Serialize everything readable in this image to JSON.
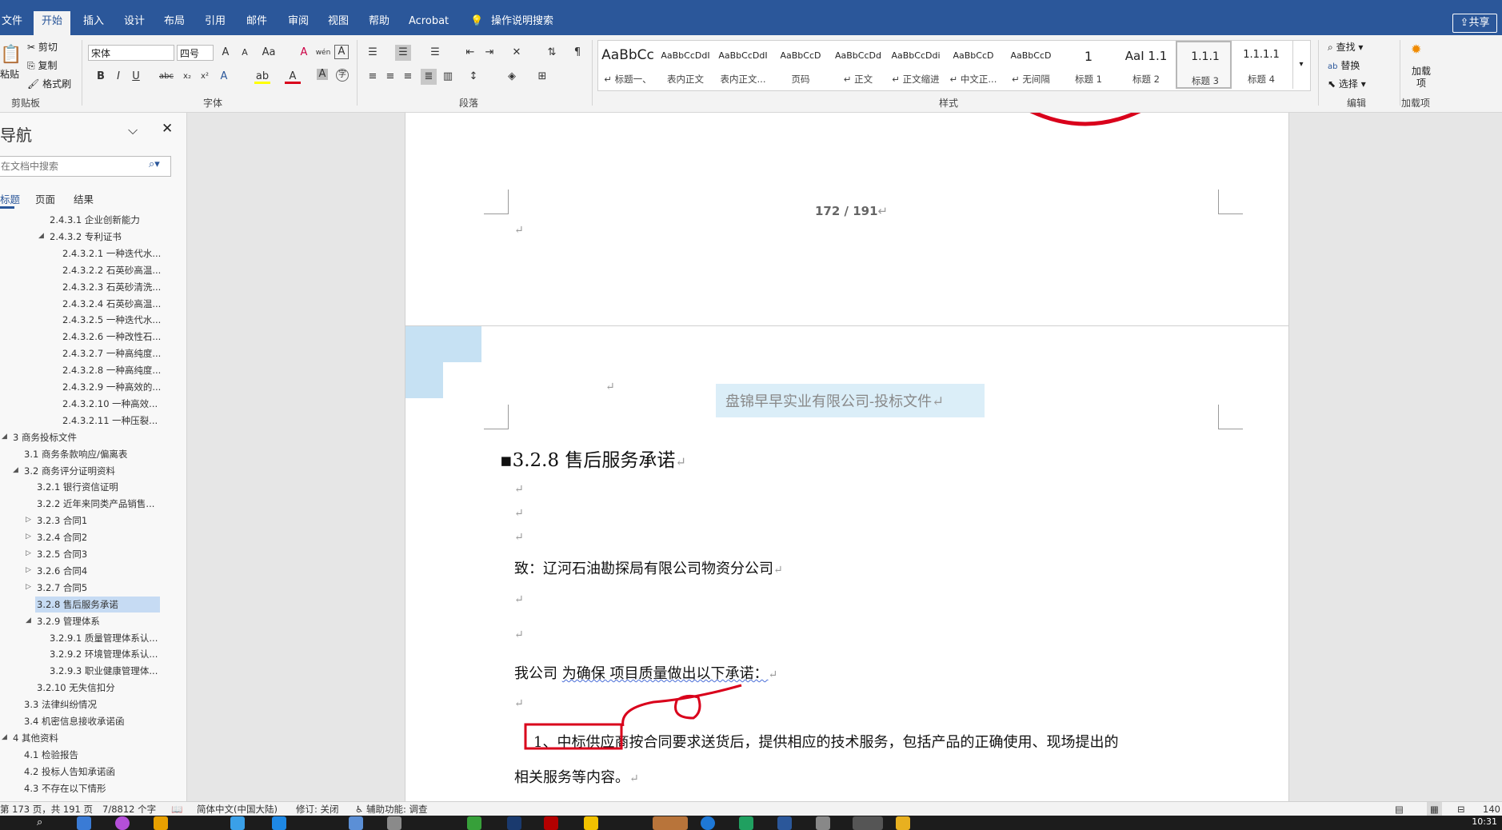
{
  "ribbon_tabs": [
    "文件",
    "开始",
    "插入",
    "设计",
    "布局",
    "引用",
    "邮件",
    "审阅",
    "视图",
    "帮助",
    "Acrobat"
  ],
  "tell_me": "操作说明搜索",
  "share": "共享",
  "clipboard": {
    "paste": "粘贴",
    "cut": "剪切",
    "copy": "复制",
    "format_painter": "格式刷",
    "label": "剪贴板"
  },
  "font": {
    "name": "宋体",
    "size": "四号",
    "label": "字体",
    "bold": "B",
    "italic": "I",
    "underline": "U",
    "strike": "abc"
  },
  "paragraph": {
    "label": "段落"
  },
  "styles": {
    "label": "样式",
    "items": [
      {
        "preview": "AaBbCc",
        "name": "↵ 标题一、"
      },
      {
        "preview": "AaBbCcDdI",
        "name": "表内正文"
      },
      {
        "preview": "AaBbCcDdI",
        "name": "表内正文..."
      },
      {
        "preview": "AaBbCcD",
        "name": "页码"
      },
      {
        "preview": "AaBbCcDd",
        "name": "↵ 正文"
      },
      {
        "preview": "AaBbCcDdi",
        "name": "↵ 正文缩进"
      },
      {
        "preview": "AaBbCcD",
        "name": "↵ 中文正..."
      },
      {
        "preview": "AaBbCcD",
        "name": "↵ 无间隔"
      },
      {
        "preview": "1",
        "name": "标题 1"
      },
      {
        "preview": "AaI 1.1",
        "name": "标题 2"
      },
      {
        "preview": "1.1.1",
        "name": "标题 3"
      },
      {
        "preview": "1.1.1.1",
        "name": "标题 4"
      }
    ]
  },
  "editing": {
    "find": "查找",
    "replace": "替换",
    "select": "选择",
    "label": "编辑"
  },
  "addins": {
    "btn": "加载项",
    "label": "加载项"
  },
  "nav": {
    "title": "导航",
    "search_placeholder": "在文档中搜索",
    "tabs": [
      "标题",
      "页面",
      "结果"
    ],
    "outline": [
      {
        "text": "2.4.3.1 企业创新能力",
        "level": 3,
        "exp": ""
      },
      {
        "text": "2.4.3.2 专利证书",
        "level": 3,
        "exp": "open"
      },
      {
        "text": "2.4.3.2.1 一种迭代水...",
        "level": 4,
        "exp": ""
      },
      {
        "text": "2.4.3.2.2 石英砂高温...",
        "level": 4,
        "exp": ""
      },
      {
        "text": "2.4.3.2.3 石英砂清洗...",
        "level": 4,
        "exp": ""
      },
      {
        "text": "2.4.3.2.4 石英砂高温...",
        "level": 4,
        "exp": ""
      },
      {
        "text": "2.4.3.2.5 一种迭代水...",
        "level": 4,
        "exp": ""
      },
      {
        "text": "2.4.3.2.6 一种改性石...",
        "level": 4,
        "exp": ""
      },
      {
        "text": "2.4.3.2.7 一种高纯度...",
        "level": 4,
        "exp": ""
      },
      {
        "text": "2.4.3.2.8 一种高纯度...",
        "level": 4,
        "exp": ""
      },
      {
        "text": "2.4.3.2.9 一种高效的...",
        "level": 4,
        "exp": ""
      },
      {
        "text": "2.4.3.2.10 一种高效...",
        "level": 4,
        "exp": ""
      },
      {
        "text": "2.4.3.2.11 一种压裂...",
        "level": 4,
        "exp": ""
      },
      {
        "text": "3 商务投标文件",
        "level": 0,
        "exp": "open"
      },
      {
        "text": "3.1 商务条款响应/偏离表",
        "level": 1,
        "exp": ""
      },
      {
        "text": "3.2 商务评分证明资料",
        "level": 1,
        "exp": "open"
      },
      {
        "text": "3.2.1 银行资信证明",
        "level": 2,
        "exp": ""
      },
      {
        "text": "3.2.2 近年来同类产品销售...",
        "level": 2,
        "exp": ""
      },
      {
        "text": "3.2.3 合同1",
        "level": 2,
        "exp": "closed"
      },
      {
        "text": "3.2.4 合同2",
        "level": 2,
        "exp": "closed"
      },
      {
        "text": "3.2.5 合同3",
        "level": 2,
        "exp": "closed"
      },
      {
        "text": "3.2.6 合同4",
        "level": 2,
        "exp": "closed"
      },
      {
        "text": "3.2.7 合同5",
        "level": 2,
        "exp": "closed"
      },
      {
        "text": "3.2.8 售后服务承诺",
        "level": 2,
        "exp": "",
        "selected": true
      },
      {
        "text": "3.2.9 管理体系",
        "level": 2,
        "exp": "open"
      },
      {
        "text": "3.2.9.1 质量管理体系认...",
        "level": 3,
        "exp": ""
      },
      {
        "text": "3.2.9.2 环境管理体系认...",
        "level": 3,
        "exp": ""
      },
      {
        "text": "3.2.9.3 职业健康管理体...",
        "level": 3,
        "exp": ""
      },
      {
        "text": "3.2.10 无失信扣分",
        "level": 2,
        "exp": ""
      },
      {
        "text": "3.3 法律纠纷情况",
        "level": 1,
        "exp": ""
      },
      {
        "text": "3.4 机密信息接收承诺函",
        "level": 1,
        "exp": ""
      },
      {
        "text": "4 其他资料",
        "level": 0,
        "exp": "open"
      },
      {
        "text": "4.1 检验报告",
        "level": 1,
        "exp": ""
      },
      {
        "text": "4.2 投标人告知承诺函",
        "level": 1,
        "exp": ""
      },
      {
        "text": "4.3 不存在以下情形",
        "level": 1,
        "exp": ""
      }
    ]
  },
  "doc": {
    "page_number": "172 / 191",
    "header_text": "盘锦早早实业有限公司-投标文件",
    "heading": "3.2.8  售后服务承诺",
    "to_line": "致：辽河石油勘探局有限公司物资分公司",
    "commit_prefix": "我公司",
    "commit_rest": "为确保   项目质量做出以下承诺：",
    "item1_line1": "1、中标供应商按合同要求送货后，提供相应的技术服务，包括产品的正确使用、现场提出的",
    "item1_line2": "相关服务等内容。"
  },
  "status": {
    "page": "第 173 页，共 191 页",
    "words": "7/8812 个字",
    "language": "简体中文(中国大陆)",
    "track": "修订: 关闭",
    "accessibility": "辅助功能: 调查",
    "zoom": "140"
  },
  "clock": "10:31",
  "colors": {
    "brand": "#2b579a",
    "annotation": "#d9001b",
    "header_highlight": "#dbeef8"
  }
}
